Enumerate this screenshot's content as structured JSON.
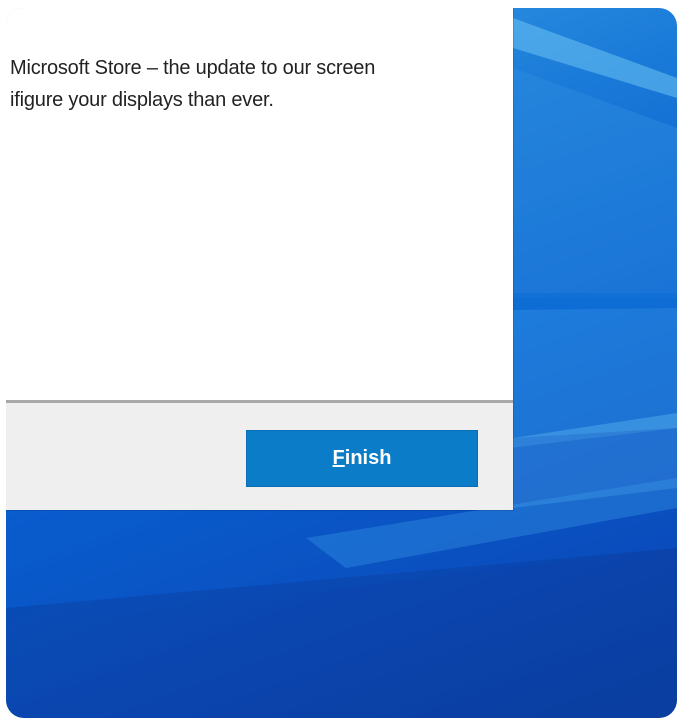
{
  "dialog": {
    "message_line1": "Microsoft Store – the update to our screen",
    "message_line2": "ifigure your displays than ever.",
    "finish_mnemonic": "F",
    "finish_rest": "inish"
  },
  "colors": {
    "button_blue": "#0b7cc7",
    "footer_gray": "#efefef",
    "wallpaper_blue": "#0b5fcf"
  }
}
